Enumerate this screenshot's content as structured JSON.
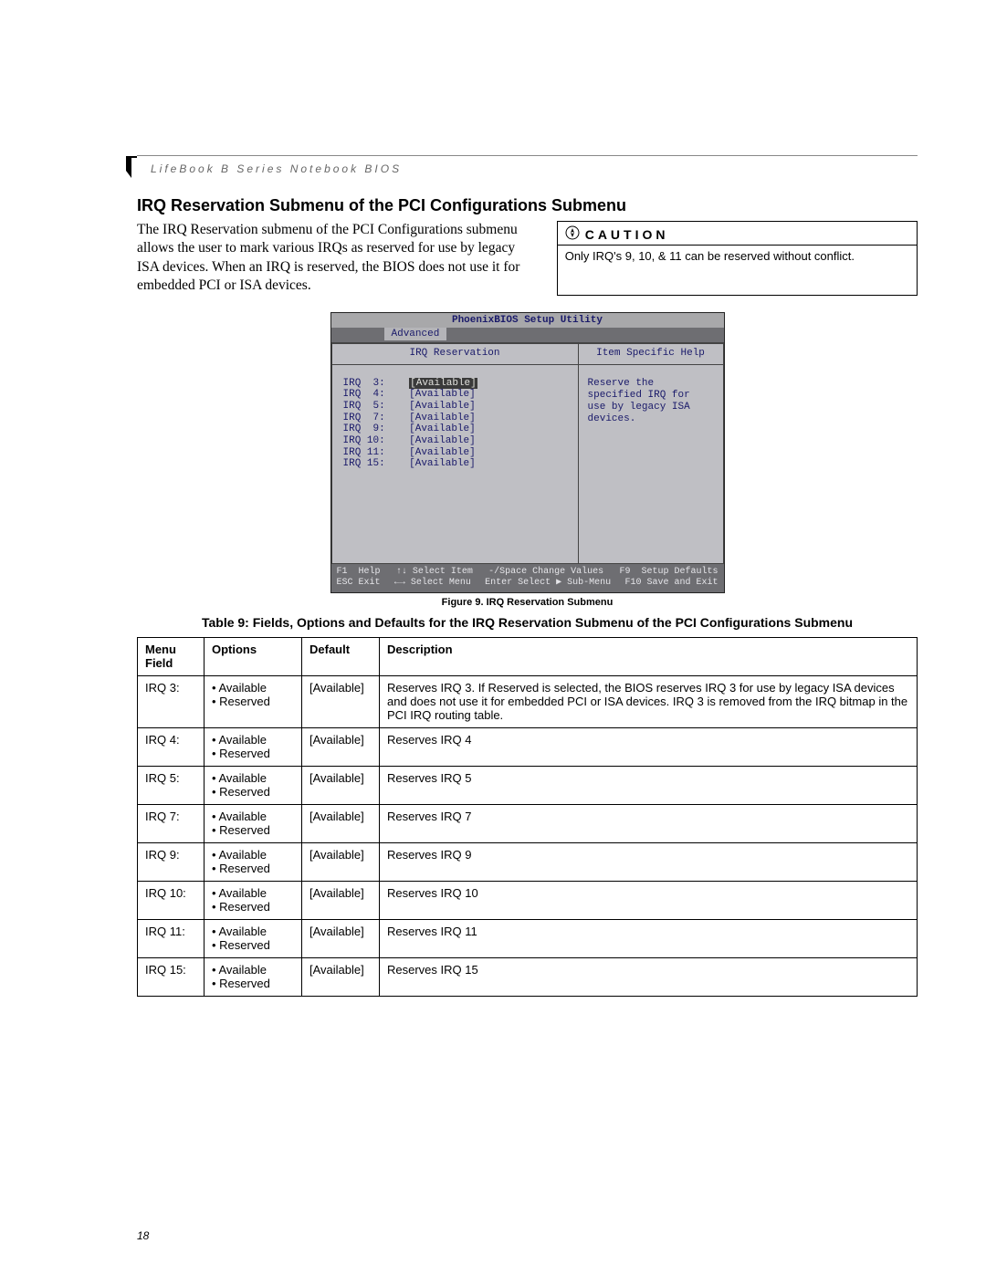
{
  "running_head": "LifeBook B Series Notebook BIOS",
  "page_number": "18",
  "section_title": "IRQ Reservation Submenu of the PCI Configurations Submenu",
  "intro_paragraph": "The IRQ Reservation submenu of the PCI Configurations submenu allows the user to mark various IRQs as reserved for use by legacy ISA devices. When an IRQ is reserved, the BIOS does not use it for embedded PCI or ISA devices.",
  "caution": {
    "label": "CAUTION",
    "text": "Only IRQ's 9, 10, & 11 can be reserved without conflict."
  },
  "bios": {
    "title": "PhoenixBIOS Setup Utility",
    "active_tab": "Advanced",
    "panel_title": "IRQ Reservation",
    "help_title": "Item Specific Help",
    "help_text": "Reserve the specified IRQ for use by legacy ISA devices.",
    "irqs": [
      {
        "label": "IRQ  3:",
        "value": "[Available]",
        "selected": true
      },
      {
        "label": "IRQ  4:",
        "value": "[Available]",
        "selected": false
      },
      {
        "label": "IRQ  5:",
        "value": "[Available]",
        "selected": false
      },
      {
        "label": "IRQ  7:",
        "value": "[Available]",
        "selected": false
      },
      {
        "label": "IRQ  9:",
        "value": "[Available]",
        "selected": false
      },
      {
        "label": "IRQ 10:",
        "value": "[Available]",
        "selected": false
      },
      {
        "label": "IRQ 11:",
        "value": "[Available]",
        "selected": false
      },
      {
        "label": "IRQ 15:",
        "value": "[Available]",
        "selected": false
      }
    ],
    "footer": {
      "r1c1": "F1  Help",
      "r1c2": "↑↓ Select Item",
      "r1c3": "-/Space Change Values",
      "r1c4": "F9  Setup Defaults",
      "r2c1": "ESC Exit",
      "r2c2": "←→ Select Menu",
      "r2c3": "Enter Select ▶ Sub-Menu",
      "r2c4": "F10 Save and Exit"
    }
  },
  "figure_caption": "Figure 9.  IRQ Reservation Submenu",
  "table_title": "Table 9: Fields, Options and Defaults for the IRQ Reservation Submenu of the PCI Configurations Submenu",
  "table": {
    "headers": {
      "menu": "Menu Field",
      "options": "Options",
      "default": "Default",
      "description": "Description"
    },
    "option_values": [
      "Available",
      "Reserved"
    ],
    "rows": [
      {
        "menu": "IRQ 3:",
        "default": "[Available]",
        "desc": "Reserves IRQ 3. If Reserved is selected, the BIOS reserves IRQ 3 for use by legacy ISA devices and does not use it for embedded PCI or ISA devices. IRQ 3 is removed from the IRQ bitmap in the PCI IRQ routing table."
      },
      {
        "menu": "IRQ 4:",
        "default": "[Available]",
        "desc": "Reserves IRQ 4"
      },
      {
        "menu": "IRQ 5:",
        "default": "[Available]",
        "desc": "Reserves IRQ 5"
      },
      {
        "menu": "IRQ 7:",
        "default": "[Available]",
        "desc": "Reserves IRQ 7"
      },
      {
        "menu": "IRQ 9:",
        "default": "[Available]",
        "desc": "Reserves IRQ 9"
      },
      {
        "menu": "IRQ 10:",
        "default": "[Available]",
        "desc": "Reserves IRQ 10"
      },
      {
        "menu": "IRQ 11:",
        "default": "[Available]",
        "desc": "Reserves IRQ 11"
      },
      {
        "menu": "IRQ 15:",
        "default": "[Available]",
        "desc": "Reserves IRQ 15"
      }
    ]
  }
}
